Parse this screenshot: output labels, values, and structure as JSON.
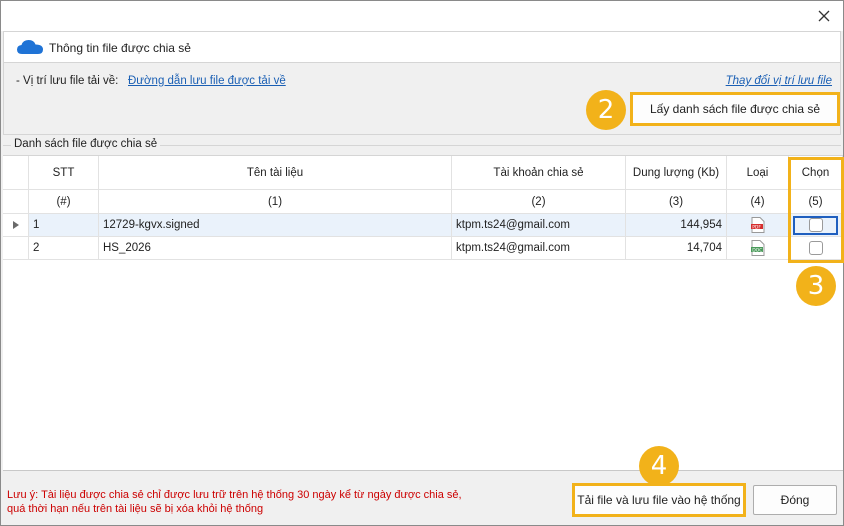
{
  "header": {
    "title": "Thông tin file được chia sẻ"
  },
  "path": {
    "label": "- Vị trí lưu file tải về:",
    "link": "Đường dẫn lưu file được tải về",
    "change_link": "Thay đổi vị trí lưu file"
  },
  "actions": {
    "get_list": "Lấy danh sách file được chia sẻ"
  },
  "group": {
    "label": "Danh sách file được chia sẻ"
  },
  "table": {
    "headers": [
      "STT",
      "Tên tài liệu",
      "Tài khoản chia sẻ",
      "Dung lượng (Kb)",
      "Loại",
      "Chọn"
    ],
    "subheaders": [
      "(#)",
      "(1)",
      "(2)",
      "(3)",
      "(4)",
      "(5)"
    ],
    "rows": [
      {
        "stt": "1",
        "name": "12729-kgvx.signed",
        "account": "ktpm.ts24@gmail.com",
        "size": "144,954",
        "type_icon": "pdf-file-icon",
        "checked": false
      },
      {
        "stt": "2",
        "name": "HS_2026",
        "account": "ktpm.ts24@gmail.com",
        "size": "14,704",
        "type_icon": "doc-file-icon",
        "checked": false
      }
    ]
  },
  "badges": {
    "b2": "2",
    "b3": "3",
    "b4": "4"
  },
  "note": {
    "line1": "Lưu ý: Tài liệu được chia sẻ chỉ được lưu trữ trên hệ thống 30 ngày kể từ ngày được chia sẻ,",
    "line2": "quá thời hạn nếu trên tài liệu sẽ bị xóa khỏi hệ thống"
  },
  "footer": {
    "download": "Tải file và lưu file vào hệ thống",
    "close": "Đóng"
  },
  "colors": {
    "highlight": "#f2b21a",
    "link": "#1a5fb4",
    "note": "#cc0000"
  }
}
